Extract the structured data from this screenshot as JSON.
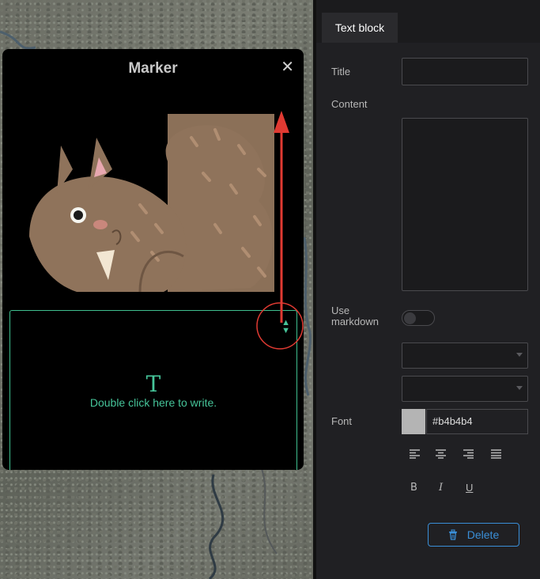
{
  "popup": {
    "title": "Marker",
    "close_icon": "close-icon"
  },
  "text_block": {
    "icon_glyph": "T",
    "hint": "Double click here to write."
  },
  "panel": {
    "tab_label": "Text block",
    "title_label": "Title",
    "title_value": "",
    "content_label": "Content",
    "content_value": "",
    "markdown_label_line1": "Use",
    "markdown_label_line2": "markdown",
    "markdown_enabled": false,
    "font_label": "Font",
    "font_color": "#b4b4b4",
    "delete_label": "Delete"
  },
  "colors": {
    "accent_green": "#46c59a",
    "annotation_red": "#e03a32",
    "delete_blue": "#3a8fd8"
  }
}
